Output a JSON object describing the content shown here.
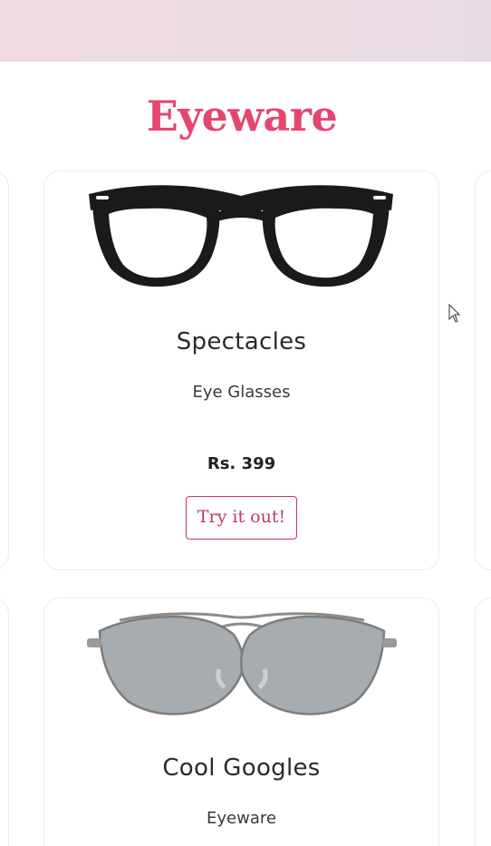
{
  "section": {
    "title": "Eyeware"
  },
  "colors": {
    "accent": "#e5466e",
    "button_border": "#c8375c",
    "banner": "#efdbe3"
  },
  "products": [
    {
      "name": "Spectacles",
      "subtitle": "Eye Glasses",
      "price": "Rs. 399",
      "button_label": "Try it out!",
      "image_icon": "black-frame-glasses-image"
    },
    {
      "name": "Cool Googles",
      "subtitle": "Eyeware",
      "image_icon": "aviator-sunglasses-image"
    }
  ]
}
